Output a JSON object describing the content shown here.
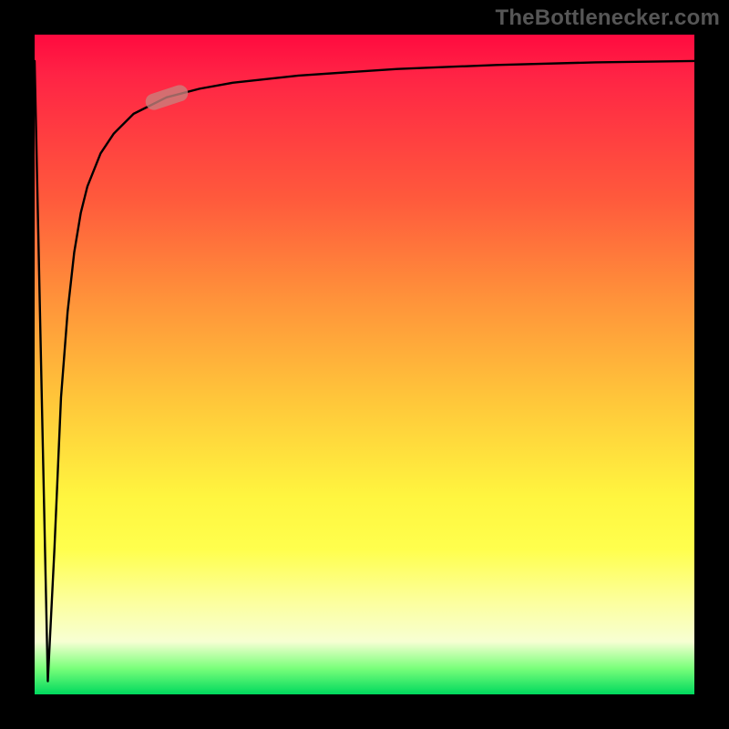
{
  "attribution": "TheBottlenecker.com",
  "colors": {
    "frame": "#000000",
    "gradient_top": "#ff0a3f",
    "gradient_bottom": "#00d95e",
    "attribution_text": "#565656",
    "curve": "#000000",
    "marker": "rgba(200,130,125,0.78)"
  },
  "chart_data": {
    "type": "line",
    "title": "",
    "xlabel": "",
    "ylabel": "",
    "xlim": [
      0,
      100
    ],
    "ylim": [
      0,
      100
    ],
    "grid": false,
    "series": [
      {
        "name": "bottleneck-curve",
        "x": [
          0,
          2,
          3,
          4,
          5,
          6,
          7,
          8,
          10,
          12,
          15,
          20,
          25,
          30,
          40,
          55,
          70,
          85,
          100
        ],
        "values": [
          96,
          2,
          22,
          45,
          58,
          67,
          73,
          77,
          82,
          85,
          88,
          90.5,
          91.8,
          92.7,
          93.8,
          94.8,
          95.4,
          95.8,
          96
        ]
      }
    ],
    "annotations": [
      {
        "name": "marker",
        "x": 20,
        "y": 90.5,
        "angle_deg": -18
      }
    ]
  }
}
